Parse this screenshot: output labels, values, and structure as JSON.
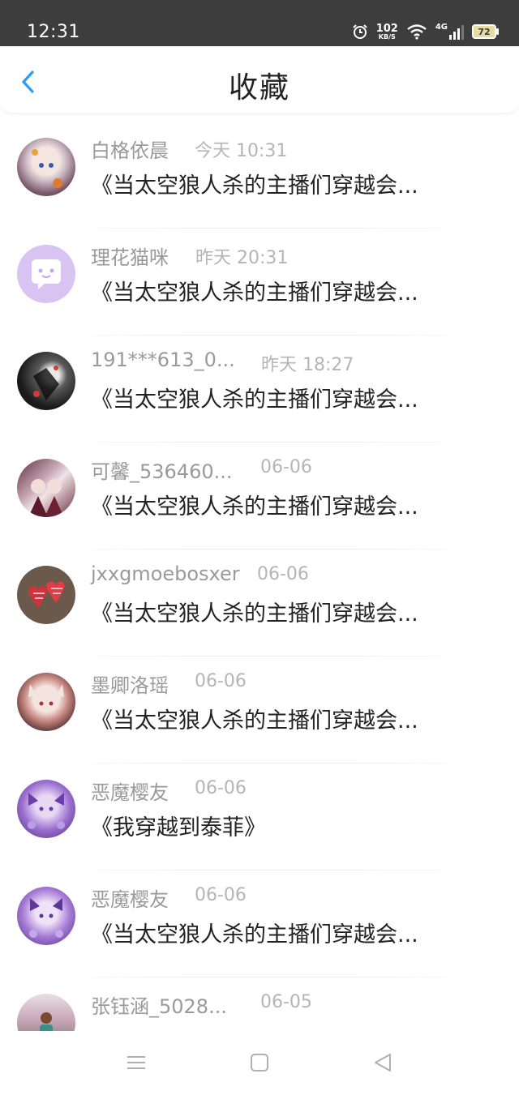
{
  "status": {
    "time": "12:31",
    "net_speed": "102",
    "net_unit": "KB/S",
    "network": "4G",
    "battery": "72"
  },
  "header": {
    "title": "收藏"
  },
  "items": [
    {
      "name": "白格依晨",
      "time": "今天 10:31",
      "title": "《当太空狼人杀的主播们穿越会..."
    },
    {
      "name": "理花猫咪",
      "time": "昨天 20:31",
      "title": "《当太空狼人杀的主播们穿越会..."
    },
    {
      "name": "191***613_0...",
      "time": "昨天 18:27",
      "title": "《当太空狼人杀的主播们穿越会..."
    },
    {
      "name": "可馨_536460...",
      "time": "06-06",
      "title": "《当太空狼人杀的主播们穿越会..."
    },
    {
      "name": "jxxgmoebosxer",
      "time": "06-06",
      "title": "《当太空狼人杀的主播们穿越会..."
    },
    {
      "name": "墨卿洛瑶",
      "time": "06-06",
      "title": "《当太空狼人杀的主播们穿越会..."
    },
    {
      "name": "恶魔樱友",
      "time": "06-06",
      "title": "《我穿越到泰菲》"
    },
    {
      "name": "恶魔樱友",
      "time": "06-06",
      "title": "《当太空狼人杀的主播们穿越会..."
    },
    {
      "name": "张钰涵_5028...",
      "time": "06-05",
      "title": ""
    }
  ],
  "colors": {
    "status_bar": "#3d3d3d",
    "accent": "#2a9df4",
    "name_gray": "#9a9a9a",
    "time_gray": "#b5b5b5"
  },
  "icons": {
    "back": "chevron-left-icon",
    "menu": "menu-icon",
    "home": "home-square-icon",
    "nav_back": "triangle-back-icon",
    "alarm": "alarm-icon",
    "wifi": "wifi-icon",
    "signal": "signal-icon"
  }
}
